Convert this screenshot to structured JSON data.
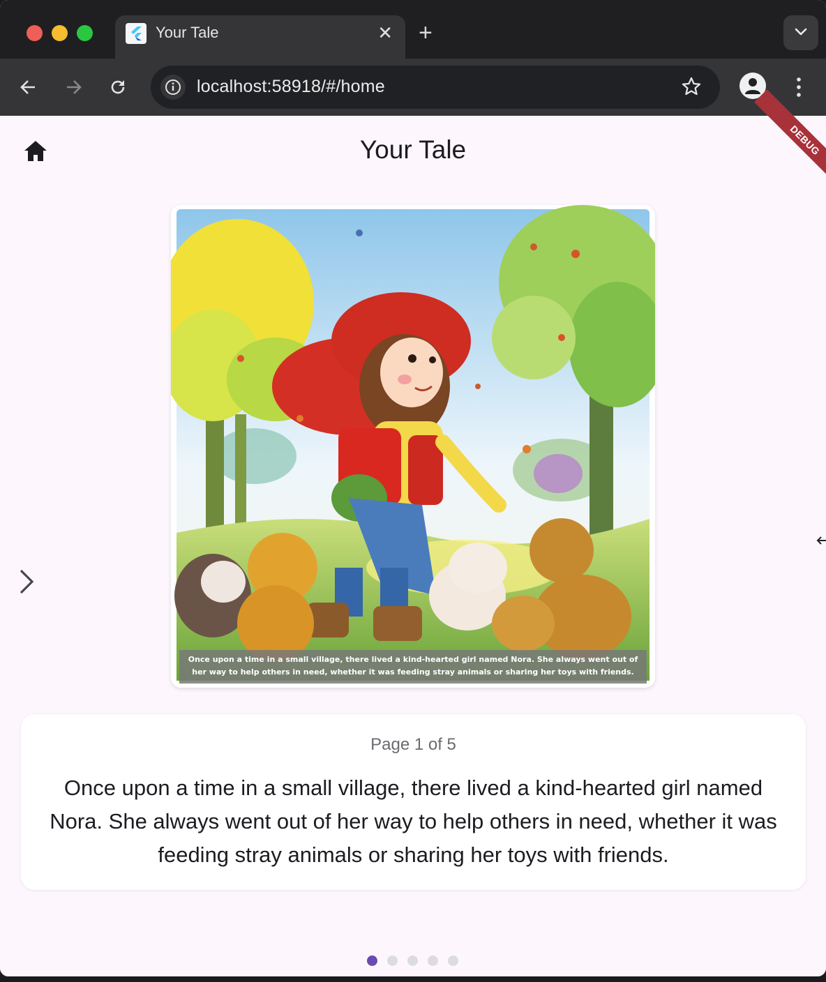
{
  "browser": {
    "tab_title": "Your Tale",
    "tab_close": "✕",
    "new_tab": "+",
    "url": "localhost:58918/#/home"
  },
  "app": {
    "title": "Your Tale",
    "debug_banner": "DEBUG",
    "illustration_caption": "Once upon a time in a small village, there lived a kind-hearted girl named Nora. She always went out of her way to help others in need, whether it was feeding stray animals or sharing her toys with friends.",
    "page_indicator": "Page 1 of 5",
    "story_text": "Once upon a time in a small village, there lived a kind-hearted girl named Nora. She always went out of her way to help others in need, whether it was feeding stray animals or sharing her toys with friends.",
    "pagination": {
      "total": 5,
      "current": 1
    }
  },
  "colors": {
    "accent": "#6a4bb0",
    "page_background": "#fdf7fd",
    "debug_banner": "#a8323a"
  }
}
